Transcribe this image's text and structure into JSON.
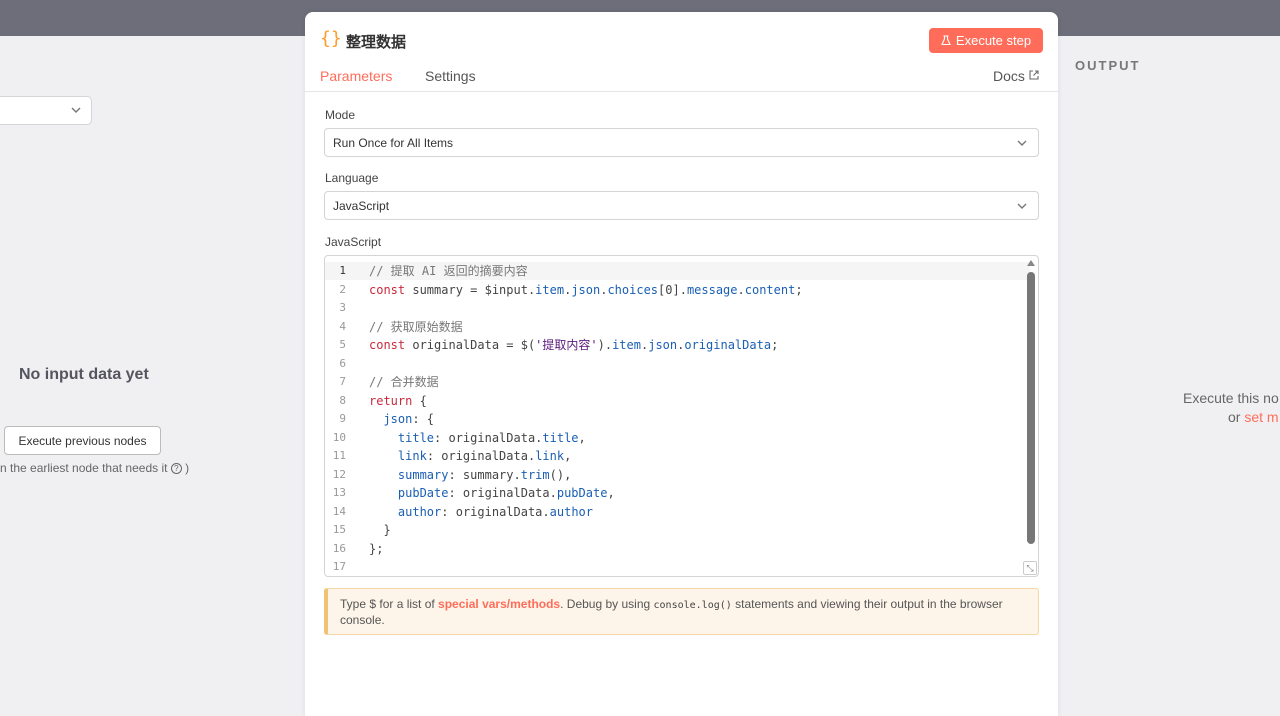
{
  "left": {
    "no_input": "No input data yet",
    "execute_previous": "Execute previous nodes",
    "hint": "n the earliest node that needs it",
    "hint_tail": " )"
  },
  "output": {
    "title": "OUTPUT",
    "message_line1": "Execute this no",
    "message_line2_prefix": "or ",
    "message_line2_link": "set m"
  },
  "node": {
    "icon": "{}",
    "title": "整理数据",
    "execute_step": "Execute step",
    "tabs": [
      "Parameters",
      "Settings"
    ],
    "active_tab": "Parameters",
    "docs": "Docs"
  },
  "fields": {
    "mode_label": "Mode",
    "mode_value": "Run Once for All Items",
    "language_label": "Language",
    "language_value": "JavaScript",
    "code_label": "JavaScript"
  },
  "code_lines": [
    "// 提取 AI 返回的摘要内容",
    "const summary = $input.item.json.choices[0].message.content;",
    "",
    "// 获取原始数据",
    "const originalData = $('提取内容').item.json.originalData;",
    "",
    "// 合并数据",
    "return {",
    "  json: {",
    "    title: originalData.title,",
    "    link: originalData.link,",
    "    summary: summary.trim(),",
    "    pubDate: originalData.pubDate,",
    "    author: originalData.author",
    "  }",
    "};",
    ""
  ],
  "notice": {
    "prefix": "Type $ for a list of ",
    "link": "special vars/methods",
    "middle": ". Debug by using ",
    "code": "console.log()",
    "suffix": " statements and viewing their output in the browser console."
  },
  "colors": {
    "accent": "#ff6d5a",
    "node_icon": "#ff9b26",
    "topbar": "#6e6e7a"
  },
  "icons": {
    "docs": "external-link-icon",
    "flask": "flask-icon",
    "help": "question-circle-icon",
    "dropdown": "chevron-down-icon"
  }
}
